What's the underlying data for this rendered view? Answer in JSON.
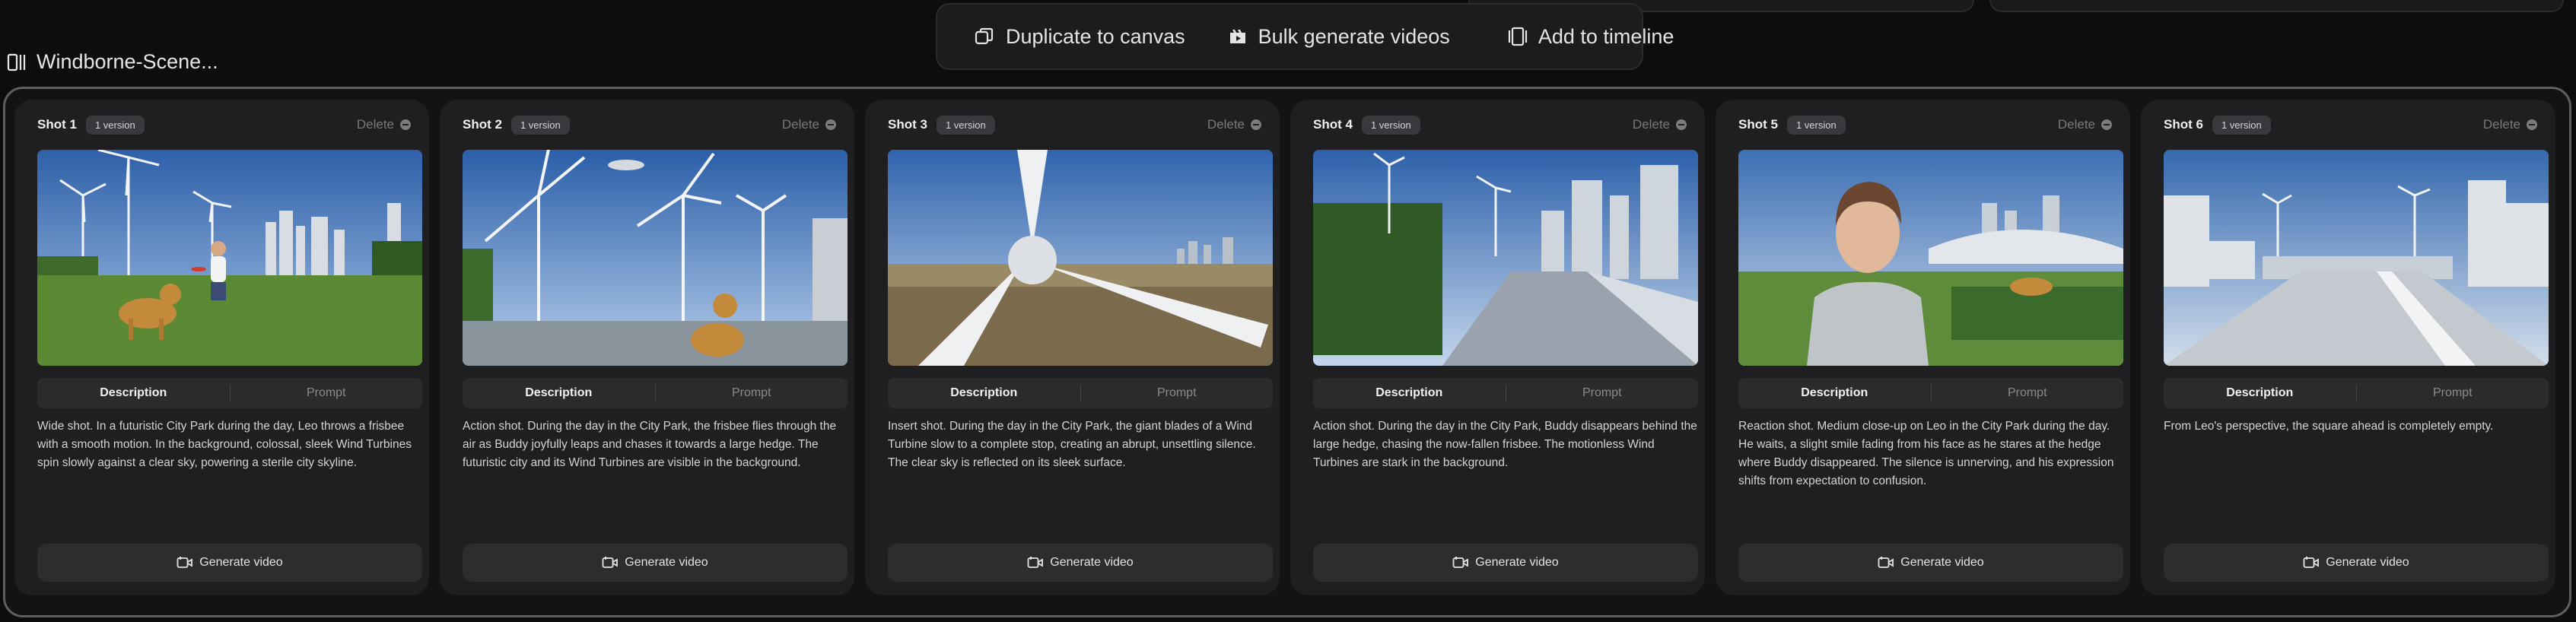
{
  "toolbar": {
    "duplicate_label": "Duplicate to canvas",
    "bulk_label": "Bulk generate videos",
    "timeline_label": "Add to timeline"
  },
  "breadcrumb": {
    "title": "Windborne-Scene..."
  },
  "shots": [
    {
      "title": "Shot 1",
      "versions": "1 version",
      "delete_label": "Delete",
      "tab_description": "Description",
      "tab_prompt": "Prompt",
      "description": "Wide shot. In a futuristic City Park during the day, Leo throws a frisbee with a smooth motion. In the background, colossal, sleek Wind Turbines spin slowly against a clear sky, powering a sterile city skyline.",
      "generate_label": "Generate video"
    },
    {
      "title": "Shot 2",
      "versions": "1 version",
      "delete_label": "Delete",
      "tab_description": "Description",
      "tab_prompt": "Prompt",
      "description": "Action shot. During the day in the City Park, the frisbee flies through the air as Buddy joyfully leaps and chases it towards a large hedge. The futuristic city and its Wind Turbines are visible in the background.",
      "generate_label": "Generate video"
    },
    {
      "title": "Shot 3",
      "versions": "1 version",
      "delete_label": "Delete",
      "tab_description": "Description",
      "tab_prompt": "Prompt",
      "description": "Insert shot. During the day in the City Park, the giant blades of a Wind Turbine slow to a complete stop, creating an abrupt, unsettling silence. The clear sky is reflected on its sleek surface.",
      "generate_label": "Generate video"
    },
    {
      "title": "Shot 4",
      "versions": "1 version",
      "delete_label": "Delete",
      "tab_description": "Description",
      "tab_prompt": "Prompt",
      "description": "Action shot. During the day in the City Park, Buddy disappears behind the large hedge, chasing the now-fallen frisbee. The motionless Wind Turbines are stark in the background.",
      "generate_label": "Generate video"
    },
    {
      "title": "Shot 5",
      "versions": "1 version",
      "delete_label": "Delete",
      "tab_description": "Description",
      "tab_prompt": "Prompt",
      "description": "Reaction shot. Medium close-up on Leo in the City Park during the day. He waits, a slight smile fading from his face as he stares at the hedge where Buddy disappeared. The silence is unnerving, and his expression shifts from expectation to confusion.",
      "generate_label": "Generate video"
    },
    {
      "title": "Shot 6",
      "versions": "1 version",
      "delete_label": "Delete",
      "tab_description": "Description",
      "tab_prompt": "Prompt",
      "description": "From Leo's perspective, the square ahead is completely empty.",
      "generate_label": "Generate video"
    }
  ]
}
